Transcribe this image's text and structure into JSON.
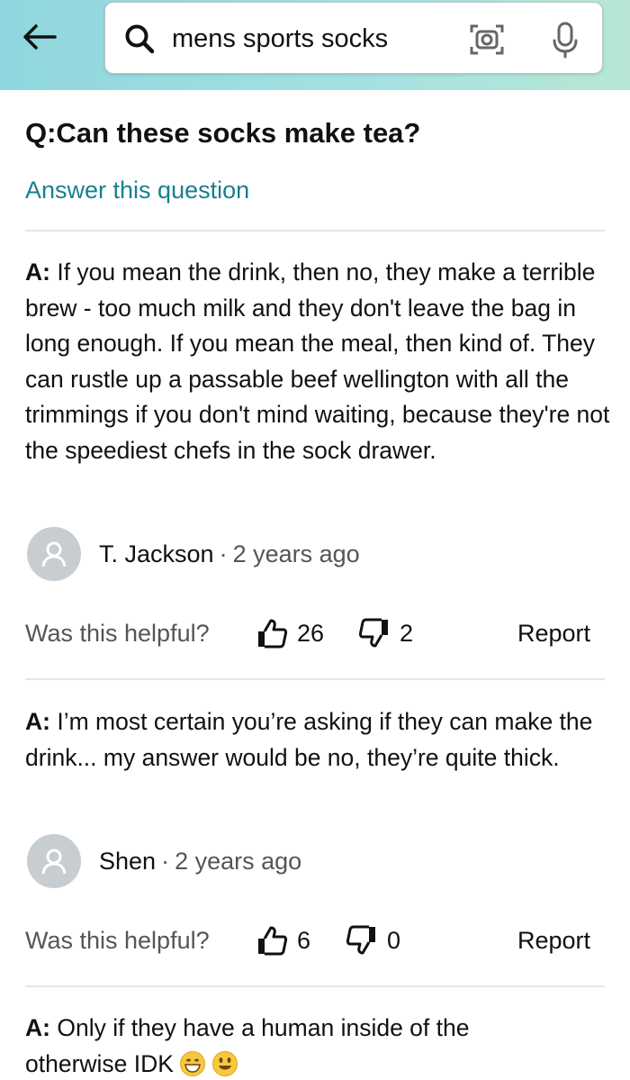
{
  "search": {
    "query": "mens sports socks"
  },
  "question": {
    "text": "Q:Can these socks make tea?",
    "answer_link": "Answer this question"
  },
  "answers": [
    {
      "prefix": "A:",
      "text": "If you mean the drink, then no, they make a terrible brew - too much milk and they don't leave the bag in long enough. If you mean the meal, then kind of. They can rustle up a passable beef wellington with all the trimmings if you don't mind waiting, because they're not the speediest chefs in the sock drawer.",
      "author": "T. Jackson",
      "separator": "·",
      "time": "2 years ago",
      "helpful_label": "Was this helpful?",
      "upvotes": "26",
      "downvotes": "2",
      "report": "Report"
    },
    {
      "prefix": "A:",
      "text": "I’m most certain you’re asking if they can make the drink... my answer would be no, they’re quite thick.",
      "author": "Shen",
      "separator": "·",
      "time": "2 years ago",
      "helpful_label": "Was this helpful?",
      "upvotes": "6",
      "downvotes": "0",
      "report": "Report"
    },
    {
      "prefix": "A:",
      "text": "Only if they have a human inside of the otherwise IDK",
      "emojis": [
        "grinning-face-emoji",
        "smiling-face-emoji"
      ]
    }
  ],
  "colors": {
    "header_start": "#8fd6de",
    "header_end": "#b7e7d4",
    "link": "#1a7f8e",
    "avatar": "#c7cdd1"
  }
}
